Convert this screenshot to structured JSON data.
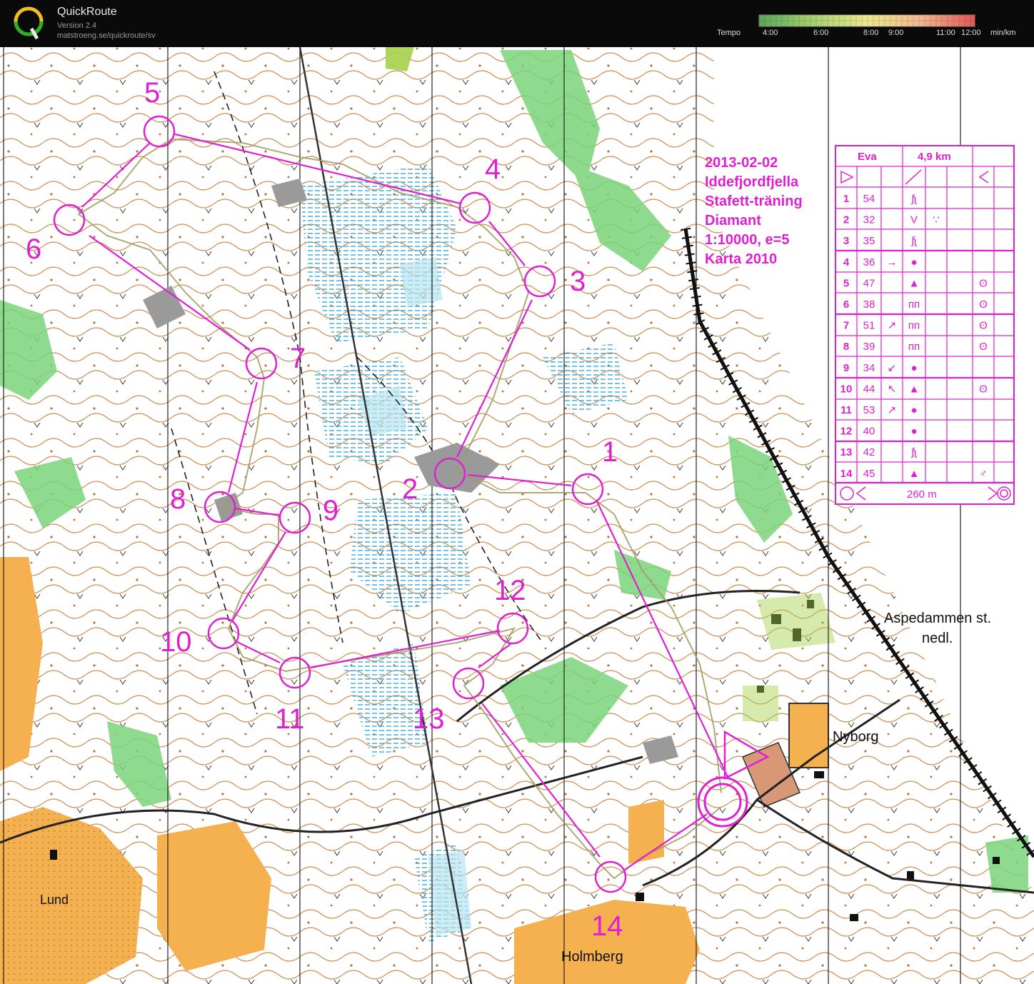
{
  "app": {
    "title": "QuickRoute",
    "version": "Version 2.4",
    "url": "matstroeng.se/quickroute/sv"
  },
  "tempo": {
    "label": "Tempo",
    "ticks": [
      "4:00",
      "6:00",
      "8:00",
      "9:00",
      "11:00",
      "12:00"
    ],
    "unit": "min/km",
    "colors": [
      "#66b266",
      "#a6d26a",
      "#e6e68a",
      "#f0c070",
      "#f09090",
      "#e06060"
    ]
  },
  "event": {
    "date": "2013-02-02",
    "area": "Iddefjordfjella",
    "type": "Stafett-träning",
    "course": "Diamant",
    "scale": "1:10000, e=5",
    "map_year": "Karta 2010"
  },
  "control_card": {
    "name": "Eva",
    "length": "4,9 km",
    "rows": [
      {
        "n": "1",
        "code": "54",
        "dir": "",
        "feature": "ʃʅ",
        "extra": "",
        "where": ""
      },
      {
        "n": "2",
        "code": "32",
        "dir": "",
        "feature": "V",
        "extra": "∵",
        "where": ""
      },
      {
        "n": "3",
        "code": "35",
        "dir": "",
        "feature": "ʃʅ",
        "extra": "",
        "where": ""
      },
      {
        "n": "4",
        "code": "36",
        "dir": "→",
        "feature": "●",
        "extra": "",
        "where": ""
      },
      {
        "n": "5",
        "code": "47",
        "dir": "",
        "feature": "▲",
        "extra": "",
        "where": "ʘ"
      },
      {
        "n": "6",
        "code": "38",
        "dir": "",
        "feature": "ᴨᴨ",
        "extra": "",
        "where": "ʘ"
      },
      {
        "n": "7",
        "code": "51",
        "dir": "↗",
        "feature": "ᴨᴨ",
        "extra": "",
        "where": "ʘ"
      },
      {
        "n": "8",
        "code": "39",
        "dir": "",
        "feature": "ᴨᴨ",
        "extra": "",
        "where": "ʘ"
      },
      {
        "n": "9",
        "code": "34",
        "dir": "↙",
        "feature": "●",
        "extra": "",
        "where": ""
      },
      {
        "n": "10",
        "code": "44",
        "dir": "↖",
        "feature": "▲",
        "extra": "",
        "where": "ʘ"
      },
      {
        "n": "11",
        "code": "53",
        "dir": "↗",
        "feature": "●",
        "extra": "",
        "where": ""
      },
      {
        "n": "12",
        "code": "40",
        "dir": "",
        "feature": "●",
        "extra": "",
        "where": ""
      },
      {
        "n": "13",
        "code": "42",
        "dir": "",
        "feature": "ʃʅ",
        "extra": "",
        "where": ""
      },
      {
        "n": "14",
        "code": "45",
        "dir": "",
        "feature": "▲",
        "extra": "",
        "where": "♂"
      }
    ],
    "finish_distance": "260 m"
  },
  "controls": [
    "1",
    "2",
    "3",
    "4",
    "5",
    "6",
    "7",
    "8",
    "9",
    "10",
    "11",
    "12",
    "13",
    "14"
  ],
  "places": {
    "aspedammen": "Aspedammen st.",
    "nedl": "nedl.",
    "nyborg": "Nyborg",
    "lund": "Lund",
    "holmberg": "Holmberg"
  },
  "colors": {
    "course": "#e020d0",
    "forest_green": "#6ccc6c",
    "open_land": "#f5b050",
    "water": "#60c0e0",
    "contour": "#b0601c"
  }
}
